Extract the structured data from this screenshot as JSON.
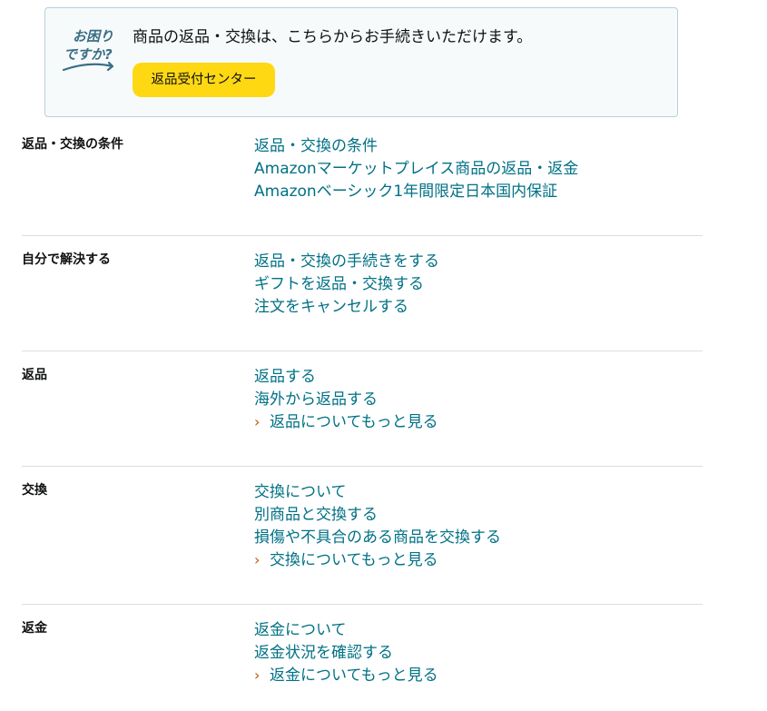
{
  "help_box": {
    "logo_line1": "お困り",
    "logo_line2": "ですか?",
    "message": "商品の返品・交換は、こちらからお手続きいただけます。",
    "button_label": "返品受付センター"
  },
  "sections": [
    {
      "title": "返品・交換の条件",
      "links": [
        "返品・交換の条件",
        "Amazonマーケットプレイス商品の返品・返金",
        "Amazonベーシック1年間限定日本国内保証"
      ]
    },
    {
      "title": "自分で解決する",
      "links": [
        "返品・交換の手続きをする",
        "ギフトを返品・交換する",
        "注文をキャンセルする"
      ]
    },
    {
      "title": "返品",
      "links": [
        "返品する",
        "海外から返品する"
      ],
      "more": "返品についてもっと見る"
    },
    {
      "title": "交換",
      "links": [
        "交換について",
        "別商品と交換する",
        "損傷や不具合のある商品を交換する"
      ],
      "more": "交換についてもっと見る"
    },
    {
      "title": "返金",
      "links": [
        "返金について",
        "返金状況を確認する"
      ],
      "more": "返金についてもっと見る"
    }
  ],
  "colors": {
    "link": "#007185",
    "chevron": "#c45500",
    "button": "#ffd814",
    "logo": "#3a6f86"
  }
}
